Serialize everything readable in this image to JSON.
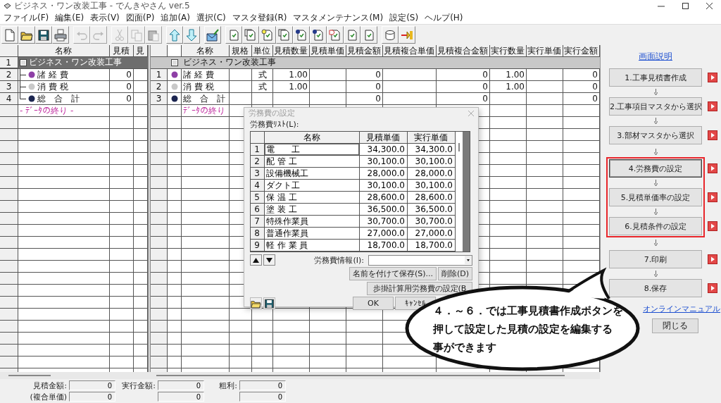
{
  "window": {
    "title": "ビジネス・ワン改装工事 - でんきやさん ver.5"
  },
  "menu": [
    "ファイル(F)",
    "編集(E)",
    "表示(V)",
    "図面(P)",
    "追加(A)",
    "選択(C)",
    "マスタ登録(R)",
    "マスタメンテナンス(M)",
    "設定(S)",
    "ヘルプ(H)"
  ],
  "toolbar": [
    {
      "kind": "new",
      "disabled": false
    },
    {
      "kind": "open",
      "disabled": false
    },
    {
      "kind": "save",
      "disabled": false
    },
    {
      "kind": "print",
      "disabled": false
    },
    {
      "kind": "separator"
    },
    {
      "kind": "undo",
      "disabled": true
    },
    {
      "kind": "redo",
      "disabled": true
    },
    {
      "kind": "separator"
    },
    {
      "kind": "cut",
      "disabled": true
    },
    {
      "kind": "copy",
      "disabled": true
    },
    {
      "kind": "paste",
      "disabled": true
    },
    {
      "kind": "separator"
    },
    {
      "kind": "up",
      "disabled": false
    },
    {
      "kind": "down",
      "disabled": false
    },
    {
      "kind": "separator"
    },
    {
      "kind": "mail",
      "disabled": false
    },
    {
      "kind": "separator"
    },
    {
      "kind": "doc",
      "disabled": false
    },
    {
      "kind": "doc-stack",
      "disabled": false
    },
    {
      "kind": "doc-bulb",
      "disabled": false
    },
    {
      "kind": "doc-stack",
      "disabled": false
    },
    {
      "kind": "doc-ball",
      "disabled": false
    },
    {
      "kind": "doc-ball",
      "disabled": false
    },
    {
      "kind": "doc-tag",
      "disabled": false
    },
    {
      "kind": "doc",
      "disabled": false
    },
    {
      "kind": "doc",
      "disabled": false
    },
    {
      "kind": "separator"
    },
    {
      "kind": "db",
      "disabled": false
    },
    {
      "kind": "tool",
      "disabled": false
    }
  ],
  "left_grid": {
    "columns": [
      "名称",
      "見積",
      "見"
    ],
    "rows": [
      {
        "kind": "group",
        "no": "1",
        "name": "ビジネス・ワン改装工事",
        "selected": true
      },
      {
        "kind": "item",
        "no": "2",
        "name": "諸 経 費",
        "color": "#8e3fa6",
        "value": "0"
      },
      {
        "kind": "item",
        "no": "3",
        "name": "消 費 税",
        "color": "#c8c8c8",
        "value": "0"
      },
      {
        "kind": "item",
        "no": "4",
        "name": "総　合　計",
        "color": "#1c2550",
        "value": "0"
      },
      {
        "kind": "end",
        "name": "- ﾃﾞｰﾀの終り -"
      }
    ]
  },
  "right_grid": {
    "columns": [
      "名称",
      "規格",
      "単位",
      "見積数量",
      "見積単価",
      "見積金額",
      "見積複合単価",
      "見積複合金額",
      "実行数量",
      "実行単価",
      "実行金額"
    ],
    "rows": [
      {
        "kind": "group",
        "name": "ビジネス・ワン改装工事",
        "selected": false
      },
      {
        "kind": "item",
        "no": "1",
        "name": "諸 経 費",
        "color": "#8e3fa6",
        "cells": [
          null,
          "式",
          "1.00",
          null,
          "0",
          null,
          "0",
          "1.00",
          null,
          "0"
        ]
      },
      {
        "kind": "item",
        "no": "2",
        "name": "消 費 税",
        "color": "#c8c8c8",
        "cells": [
          null,
          "式",
          "1.00",
          null,
          "0",
          null,
          "0",
          "1.00",
          null,
          "0"
        ]
      },
      {
        "kind": "item",
        "no": "3",
        "name": "総　合　計",
        "color": "#1c2550",
        "cells": [
          null,
          null,
          null,
          null,
          "0",
          null,
          "0",
          null,
          null,
          "0"
        ]
      },
      {
        "kind": "end",
        "name": "ﾃﾞｰﾀの終り"
      }
    ]
  },
  "dialog": {
    "title": "労務費の設定",
    "list_label": "労務費ﾘｽﾄ(L):",
    "columns": [
      "名称",
      "見積単価",
      "実行単価"
    ],
    "rows": [
      {
        "no": "1",
        "name": "電　　工",
        "estimate": "34,300.0",
        "actual": "34,300.0",
        "selected": true
      },
      {
        "no": "2",
        "name": "配 管 工",
        "estimate": "30,100.0",
        "actual": "30,100.0",
        "selected": false
      },
      {
        "no": "3",
        "name": "設備機械工",
        "estimate": "28,000.0",
        "actual": "28,000.0",
        "selected": false
      },
      {
        "no": "4",
        "name": "ダクト工",
        "estimate": "30,100.0",
        "actual": "30,100.0",
        "selected": false
      },
      {
        "no": "5",
        "name": "保 温 工",
        "estimate": "28,600.0",
        "actual": "28,600.0",
        "selected": false
      },
      {
        "no": "6",
        "name": "塗 装 工",
        "estimate": "36,500.0",
        "actual": "36,500.0",
        "selected": false
      },
      {
        "no": "7",
        "name": "特殊作業員",
        "estimate": "30,700.0",
        "actual": "30,700.0",
        "selected": false
      },
      {
        "no": "8",
        "name": "普通作業員",
        "estimate": "27,000.0",
        "actual": "27,000.0",
        "selected": false
      },
      {
        "no": "9",
        "name": "軽 作 業 員",
        "estimate": "18,700.0",
        "actual": "18,700.0",
        "selected": false
      }
    ],
    "info_label": "労務費情報(I):",
    "save_as_button": "名前を付けて保存(S)...",
    "delete_button": "削除(D)",
    "labor_button": "歩掛計算用労務費の設定(B",
    "ok_button": "OK",
    "cancel_button": "ｷｬﾝｾﾙ"
  },
  "right_panel": {
    "title_link": "画面説明",
    "steps": [
      {
        "label": "1.工事見積書作成",
        "highlighted": false,
        "focused": false
      },
      {
        "label": "2.工事項目マスタから選択",
        "highlighted": false,
        "focused": false
      },
      {
        "label": "3.部材マスタから選択",
        "highlighted": false,
        "focused": false
      },
      {
        "label": "4.労務費の設定",
        "highlighted": true,
        "focused": true
      },
      {
        "label": "5.見積単価率の設定",
        "highlighted": true,
        "focused": false
      },
      {
        "label": "6.見積条件の設定",
        "highlighted": true,
        "focused": false
      },
      {
        "label": "7.印刷",
        "highlighted": false,
        "focused": false
      },
      {
        "label": "8.保存",
        "highlighted": false,
        "focused": false
      }
    ],
    "manual_link": "オンラインマニュアル",
    "close_button": "閉じる"
  },
  "summary": {
    "fields": [
      {
        "label": "見積金額:",
        "value": "0"
      },
      {
        "label": "実行金額:",
        "value": "0"
      },
      {
        "label": "粗利:",
        "value": "0"
      }
    ],
    "composite_label": "(複合単価)",
    "composite_values": [
      "0",
      "0",
      "0"
    ]
  },
  "bubble": {
    "lines": [
      "４．～６．では工事見積書作成ボタンを",
      "押して設定した見積の設定を編集する",
      "事ができます"
    ]
  }
}
